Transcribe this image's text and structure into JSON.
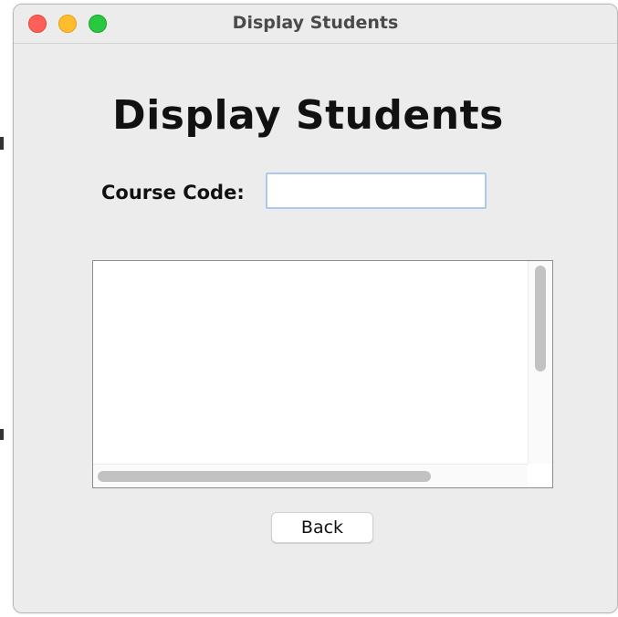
{
  "window": {
    "title": "Display Students",
    "controls": [
      "close",
      "minimize",
      "zoom"
    ],
    "colors": {
      "close": "#fe5f57",
      "minimize": "#febc2e",
      "zoom": "#28c840"
    }
  },
  "main": {
    "heading": "Display Students",
    "course_code": {
      "label": "Course Code:",
      "value": "",
      "placeholder": ""
    },
    "results": {
      "value": ""
    },
    "back_label": "Back"
  },
  "colors": {
    "window_bg": "#ececec",
    "field_focus_border": "#a9c9ef"
  }
}
